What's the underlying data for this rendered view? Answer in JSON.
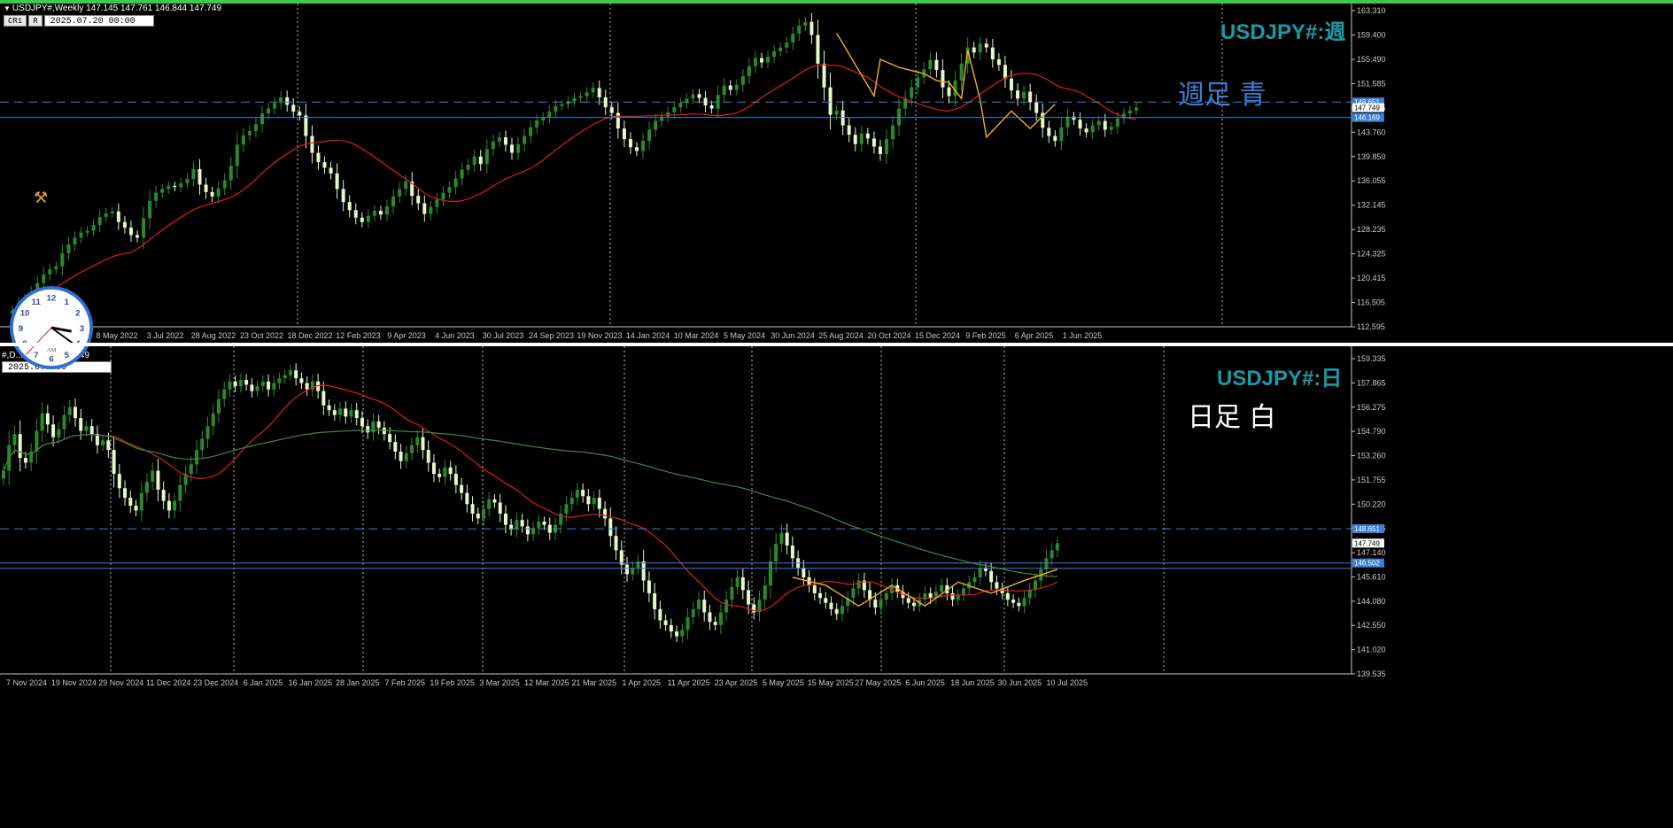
{
  "colors": {
    "bull": "#2a8a2a",
    "bear": "#e6f7c8",
    "ma_red": "#e01e1e",
    "ma_green": "#3d8a3d",
    "zigzag": "#f0b020",
    "hline": "#3b7fd6",
    "grid": "#ffffff",
    "axis": "#c8c8c8",
    "label_teal": "#1a9aa5",
    "note_blue": "#3b7fd6",
    "note_white": "#ffffff"
  },
  "top": {
    "title": "USDJPY#,Weekly  147.145 147.761 146.844 147.749",
    "toolbar": {
      "btn1": "CR1",
      "btn2": "R",
      "date": "2025.07.20 00:00"
    },
    "label": "USDJPY#:週",
    "note": "週足  青",
    "y_ticks": [
      "163.310",
      "159.400",
      "155.490",
      "151.585",
      "147.675",
      "143.760",
      "139.850",
      "136.055",
      "132.145",
      "128.235",
      "124.325",
      "120.415",
      "116.505",
      "112.595"
    ],
    "x_ticks": [
      "8 May 2022",
      "3 Jul 2022",
      "28 Aug 2022",
      "23 Oct 2022",
      "18 Dec 2022",
      "12 Feb 2023",
      "9 Apr 2023",
      "4 Jun 2023",
      "30 Jul 2023",
      "24 Sep 2023",
      "19 Nov 2023",
      "14 Jan 2024",
      "10 Mar 2024",
      "5 May 2024",
      "30 Jun 2024",
      "25 Aug 2024",
      "20 Oct 2024",
      "15 Dec 2024",
      "9 Feb 2025",
      "6 Apr 2025",
      "1 Jun 2025"
    ],
    "price_tags": [
      "148.651",
      "147.749",
      "146.169"
    ]
  },
  "bottom": {
    "title": "#,D... ...6.844 147.749",
    "toolbar": {
      "date": "2025.0...00"
    },
    "label": "USDJPY#:日",
    "note": "日足   白",
    "y_ticks": [
      "159.335",
      "157.865",
      "156.275",
      "154.790",
      "153.260",
      "151.755",
      "150.220",
      "148.735",
      "147.140",
      "145.610",
      "144.080",
      "142.550",
      "141.020",
      "139.535"
    ],
    "x_ticks": [
      "7 Nov 2024",
      "19 Nov 2024",
      "29 Nov 2024",
      "11 Dec 2024",
      "23 Dec 2024",
      "6 Jan 2025",
      "16 Jan 2025",
      "28 Jan 2025",
      "7 Feb 2025",
      "19 Feb 2025",
      "3 Mar 2025",
      "12 Mar 2025",
      "21 Mar 2025",
      "1 Apr 2025",
      "11 Apr 2025",
      "23 Apr 2025",
      "5 May 2025",
      "15 May 2025",
      "27 May 2025",
      "6 Jun 2025",
      "18 Jun 2025",
      "30 Jun 2025",
      "10 Jul 2025"
    ],
    "price_tags": [
      "148.651",
      "147.749",
      "146.502"
    ]
  },
  "clock": {
    "label": "AM",
    "hour": 3,
    "minute": 21
  },
  "chart_data": [
    {
      "type": "candlestick",
      "title": "USDJPY#,Weekly",
      "ylim": [
        112.595,
        163.31
      ],
      "hlines": [
        148.651,
        146.169
      ],
      "closes": [
        115.2,
        116.4,
        117.0,
        118.1,
        119.6,
        121.0,
        121.8,
        122.3,
        124.4,
        125.8,
        126.9,
        127.7,
        128.0,
        128.9,
        130.2,
        130.8,
        131.1,
        129.4,
        128.5,
        127.3,
        126.9,
        130.0,
        132.8,
        134.1,
        134.7,
        135.2,
        135.0,
        135.6,
        136.3,
        137.9,
        135.4,
        134.2,
        133.5,
        134.8,
        136.1,
        138.4,
        141.8,
        143.3,
        144.0,
        145.1,
        146.8,
        147.6,
        148.5,
        149.4,
        148.2,
        147.1,
        146.5,
        143.2,
        140.5,
        139.0,
        138.1,
        137.2,
        134.7,
        132.6,
        131.3,
        130.1,
        129.4,
        130.4,
        131.2,
        130.6,
        131.9,
        133.5,
        134.7,
        135.9,
        133.6,
        132.4,
        130.7,
        131.8,
        133.0,
        134.1,
        135.0,
        136.4,
        137.8,
        138.6,
        139.9,
        138.7,
        141.1,
        142.3,
        143.0,
        141.8,
        140.5,
        141.9,
        143.2,
        144.6,
        145.7,
        146.2,
        147.1,
        148.0,
        148.3,
        148.8,
        149.3,
        149.6,
        150.2,
        150.9,
        149.4,
        147.8,
        146.9,
        144.4,
        142.7,
        141.4,
        140.8,
        142.4,
        144.2,
        145.6,
        146.3,
        147.0,
        147.8,
        148.5,
        149.2,
        149.9,
        149.3,
        148.1,
        147.6,
        149.8,
        151.3,
        150.6,
        151.4,
        152.8,
        154.4,
        155.7,
        155.0,
        155.9,
        156.8,
        157.4,
        158.2,
        159.6,
        160.9,
        161.5,
        159.4,
        154.8,
        151.0,
        146.6,
        147.3,
        144.9,
        143.4,
        141.9,
        143.6,
        142.8,
        141.5,
        140.3,
        142.7,
        144.9,
        147.6,
        149.3,
        151.0,
        152.6,
        153.9,
        155.4,
        153.8,
        151.0,
        149.6,
        152.1,
        154.8,
        157.4,
        156.6,
        158.0,
        157.4,
        155.5,
        154.6,
        152.4,
        150.5,
        149.2,
        150.3,
        148.6,
        146.9,
        144.5,
        143.2,
        142.4,
        144.6,
        146.3,
        145.8,
        144.4,
        143.8,
        144.9,
        145.6,
        144.2,
        144.7,
        146.0,
        146.8,
        147.3,
        147.749
      ],
      "ma": "red moving average",
      "zigzag_points": [
        [
          132,
          159.7
        ],
        [
          138,
          149.6
        ],
        [
          139,
          155.5
        ],
        [
          142,
          154.2
        ],
        [
          146,
          153.2
        ],
        [
          148,
          152.1
        ],
        [
          150,
          151.8
        ],
        [
          152,
          149.2
        ],
        [
          153,
          157.0
        ],
        [
          155,
          149.0
        ],
        [
          156,
          143.0
        ],
        [
          160,
          147.2
        ],
        [
          163,
          144.4
        ],
        [
          167,
          148.3
        ]
      ]
    },
    {
      "type": "candlestick",
      "title": "USDJPY#,Daily",
      "ylim": [
        139.535,
        159.335
      ],
      "hlines": [
        148.651,
        146.502,
        146.169
      ],
      "closes": [
        152.3,
        153.9,
        154.6,
        153.1,
        152.8,
        153.5,
        154.8,
        155.9,
        155.2,
        154.4,
        154.9,
        155.8,
        156.3,
        155.6,
        154.8,
        155.1,
        154.6,
        153.9,
        154.2,
        153.6,
        152.1,
        151.2,
        150.6,
        150.1,
        149.8,
        150.9,
        151.6,
        152.3,
        151.1,
        150.4,
        149.8,
        150.4,
        151.4,
        152.1,
        152.7,
        153.6,
        154.3,
        155.1,
        155.9,
        156.8,
        157.4,
        157.9,
        157.6,
        158.0,
        157.7,
        157.3,
        157.6,
        157.9,
        157.4,
        157.8,
        158.1,
        158.3,
        158.6,
        158.1,
        157.8,
        157.4,
        157.9,
        157.3,
        156.4,
        156.1,
        155.8,
        156.2,
        155.7,
        156.1,
        155.6,
        155.1,
        154.7,
        155.4,
        155.0,
        154.6,
        154.1,
        153.5,
        152.9,
        153.4,
        153.9,
        154.4,
        153.6,
        152.8,
        152.1,
        151.9,
        152.5,
        152.1,
        151.4,
        150.9,
        150.2,
        149.6,
        149.3,
        149.9,
        150.5,
        150.3,
        149.6,
        148.9,
        148.6,
        149.2,
        148.8,
        148.3,
        148.7,
        149.1,
        148.9,
        148.4,
        148.9,
        149.6,
        150.2,
        150.6,
        151.1,
        150.7,
        150.2,
        150.6,
        149.9,
        149.3,
        148.2,
        147.3,
        146.4,
        145.8,
        146.2,
        146.6,
        145.4,
        144.6,
        143.6,
        142.9,
        142.6,
        142.2,
        141.9,
        142.3,
        143.1,
        143.6,
        144.2,
        143.4,
        142.8,
        142.6,
        143.4,
        144.2,
        145.0,
        145.6,
        144.8,
        143.9,
        143.4,
        144.2,
        145.1,
        146.6,
        147.7,
        148.4,
        147.6,
        146.8,
        146.2,
        145.6,
        145.1,
        144.6,
        144.3,
        144.0,
        143.6,
        143.3,
        143.8,
        144.3,
        144.9,
        145.4,
        144.8,
        144.2,
        143.7,
        144.2,
        144.6,
        145.1,
        144.7,
        144.3,
        144.0,
        143.8,
        144.2,
        144.6,
        144.3,
        144.7,
        145.1,
        144.6,
        144.2,
        144.5,
        144.9,
        145.3,
        145.6,
        146.2,
        146.0,
        145.3,
        144.9,
        144.6,
        144.2,
        144.0,
        143.8,
        144.3,
        144.8,
        145.4,
        146.1,
        146.8,
        147.3,
        147.749
      ],
      "ma": [
        "red moving average",
        "green moving average"
      ]
    }
  ]
}
